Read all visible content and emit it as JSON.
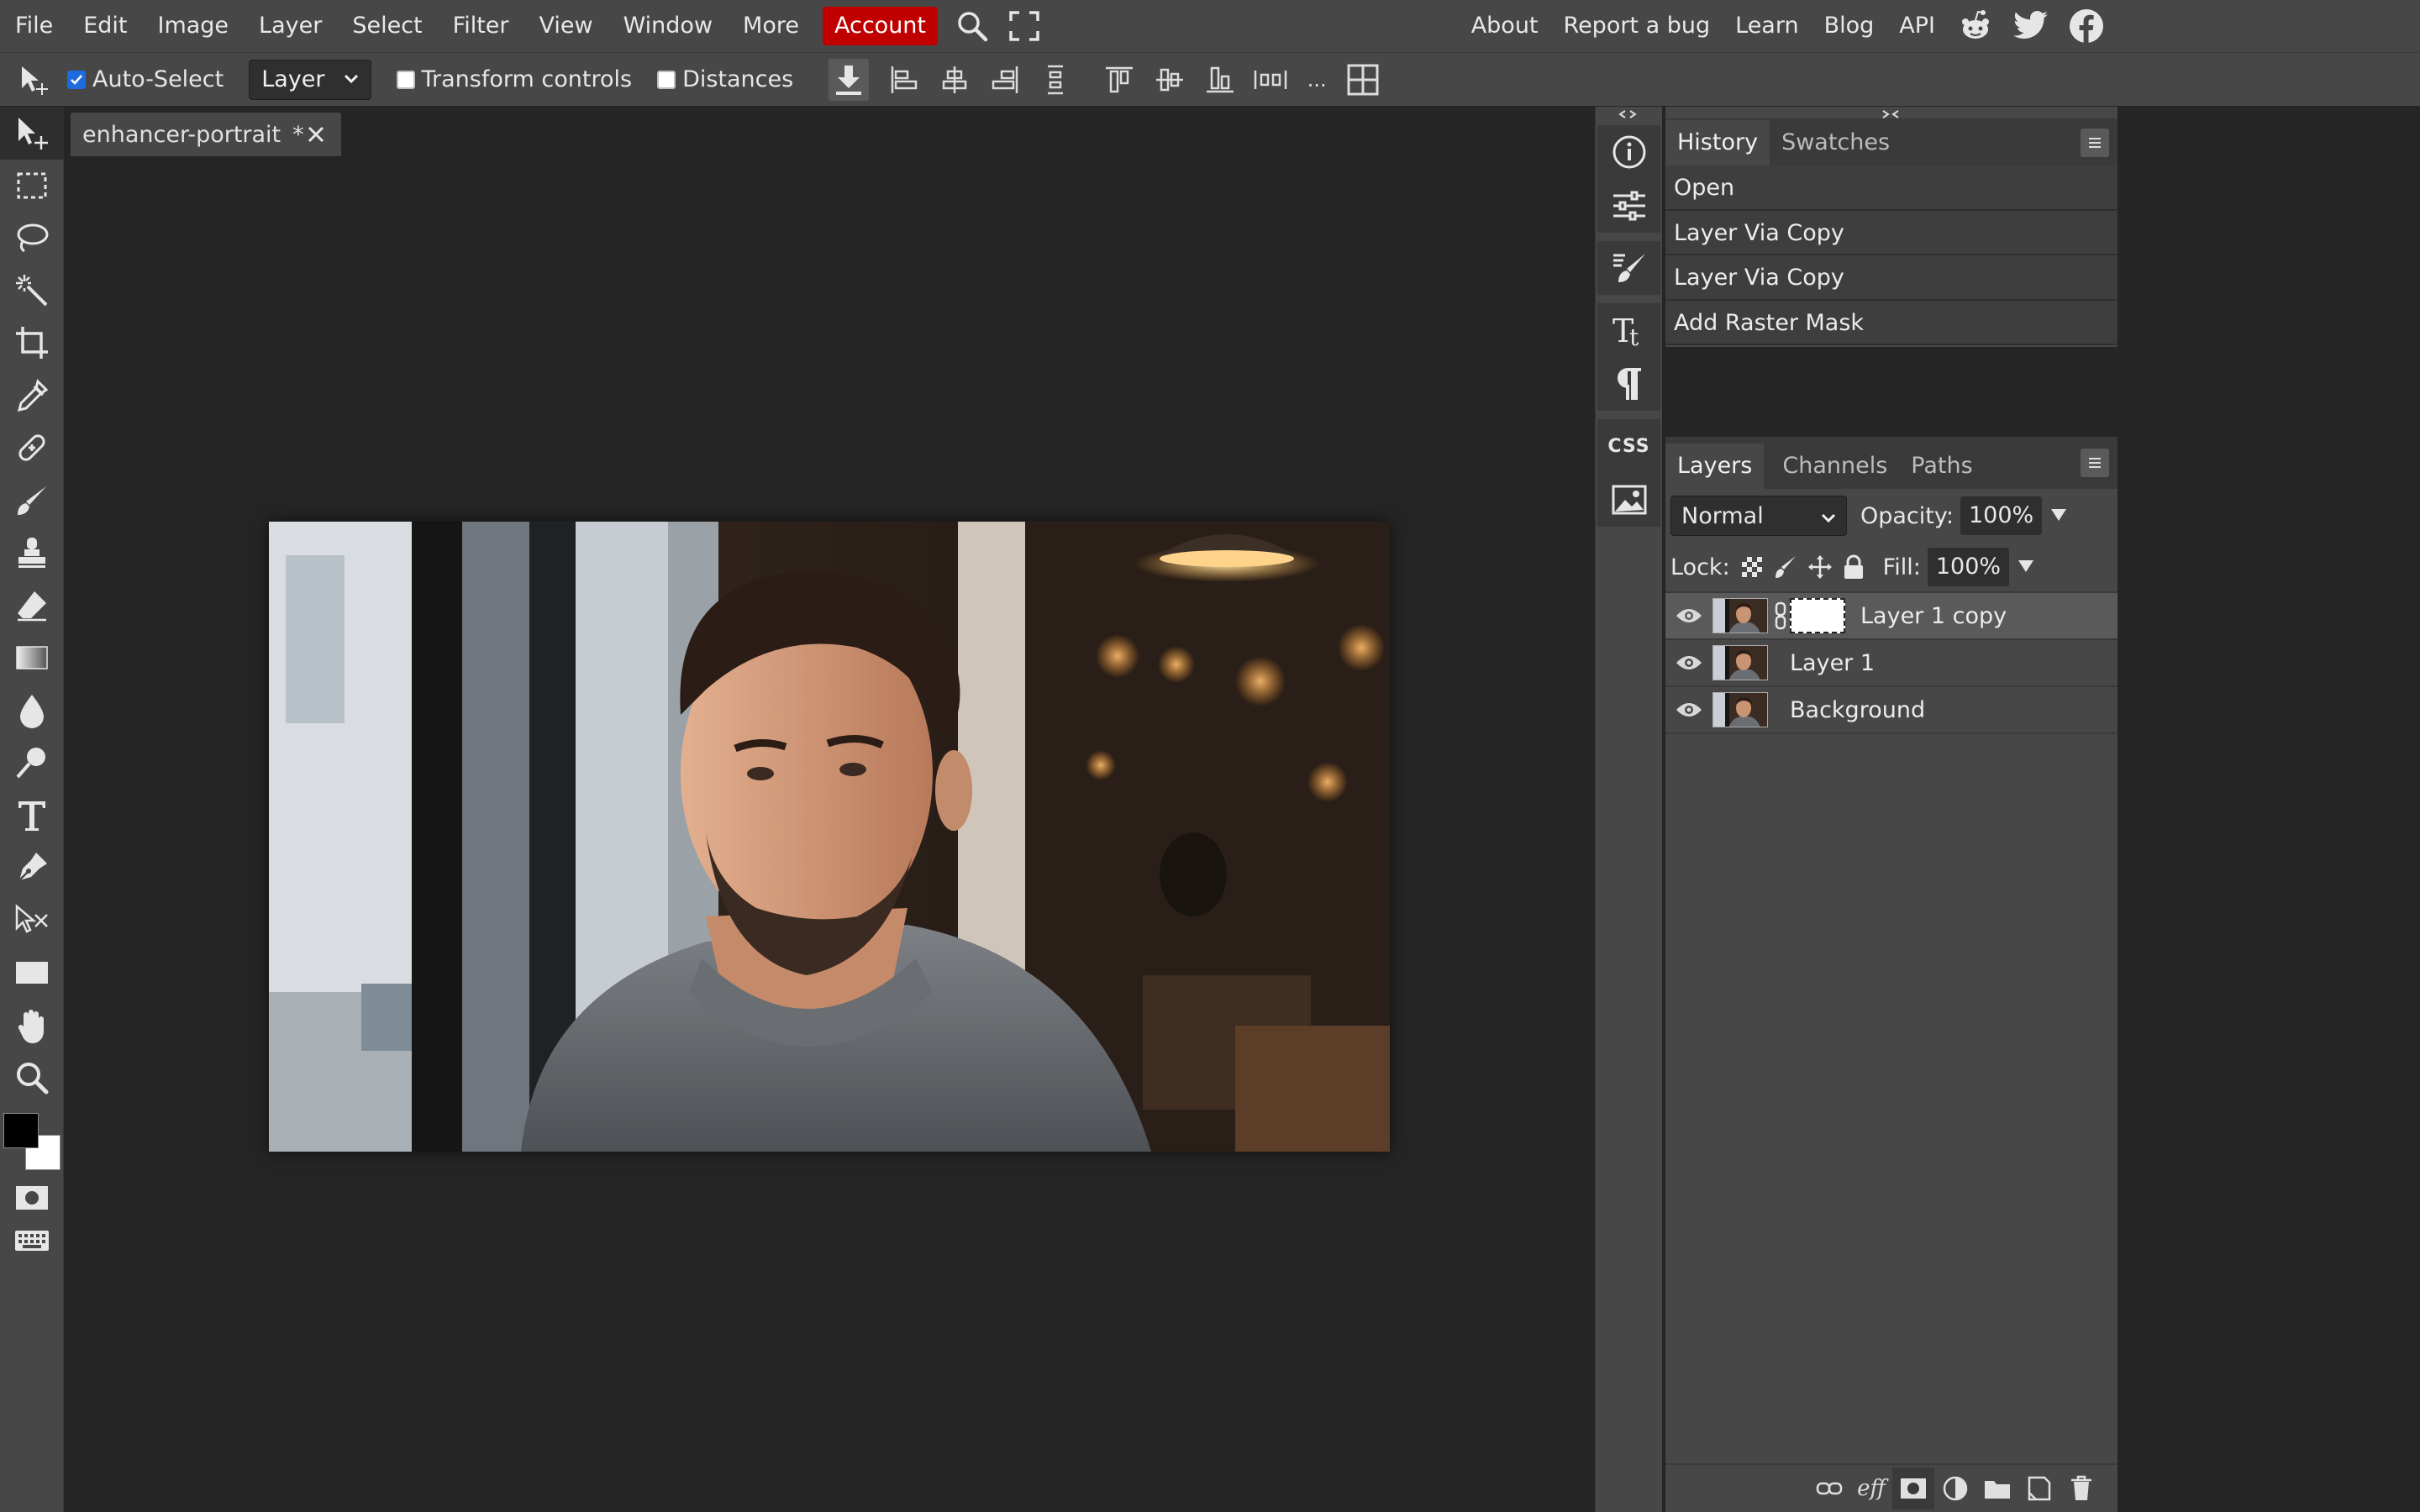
{
  "menubar": {
    "items": [
      "File",
      "Edit",
      "Image",
      "Layer",
      "Select",
      "Filter",
      "View",
      "Window",
      "More"
    ],
    "account": "Account",
    "right_items": [
      "About",
      "Report a bug",
      "Learn",
      "Blog",
      "API"
    ]
  },
  "options": {
    "auto_select_label": "Auto-Select",
    "auto_select_checked": true,
    "target_select": "Layer",
    "transform_label": "Transform controls",
    "distances_label": "Distances",
    "more": "..."
  },
  "document": {
    "tab_title": "enhancer-portrait",
    "modified_marker": "*"
  },
  "history": {
    "tabs": [
      "History",
      "Swatches"
    ],
    "active_tab": "History",
    "items": [
      "Open",
      "Layer Via Copy",
      "Layer Via Copy",
      "Add Raster Mask"
    ]
  },
  "layers_panel": {
    "tabs": [
      "Layers",
      "Channels",
      "Paths"
    ],
    "active_tab": "Layers",
    "blend_mode": "Normal",
    "opacity_label": "Opacity:",
    "opacity": "100%",
    "lock_label": "Lock:",
    "fill_label": "Fill:",
    "fill": "100%",
    "layers": [
      {
        "name": "Layer 1 copy",
        "selected": true,
        "has_mask": true
      },
      {
        "name": "Layer 1",
        "selected": false,
        "has_mask": false
      },
      {
        "name": "Background",
        "selected": false,
        "has_mask": false
      }
    ],
    "footer_effects_label": "eff"
  },
  "iconstrip": {
    "css_label": "CSS"
  },
  "colors": {
    "foreground": "#000000",
    "background": "#ffffff",
    "accent_account": "#c00000",
    "checkbox_blue": "#1e6be0"
  }
}
